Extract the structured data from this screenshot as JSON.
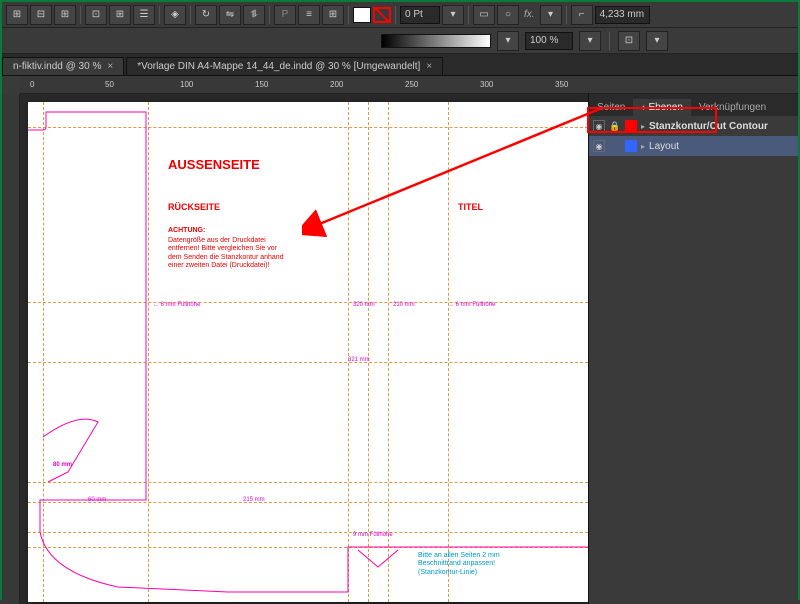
{
  "toolbar": {
    "stroke_pt": "0 Pt",
    "opacity": "100 %",
    "coord": "4,233 mm"
  },
  "tabs": {
    "t1": "n-fiktiv.indd @ 30 %",
    "t2": "*Vorlage DIN A4-Mappe 14_44_de.indd @ 30 % [Umgewandelt]"
  },
  "ruler": {
    "m0": "0",
    "m50": "50",
    "m100": "100",
    "m150": "150",
    "m200": "200",
    "m250": "250",
    "m300": "300",
    "m350": "350"
  },
  "doc": {
    "aussenseite": "AUSSENSEITE",
    "rueckseite": "RÜCKSEITE",
    "titel": "TITEL",
    "achtung_h": "ACHTUNG:",
    "achtung_t": "Datengröße aus der Druckdatei entfernen! Bitte vergleichen Sie vor dem Senden die Stanzkontur anhand einer zweiten Datei (Druckdatei)!",
    "fuell_l": "← 6 mm Füllhöhe",
    "fuell_r": "→ 6 mm Füllhöhe",
    "meas_320": "320 mm",
    "meas_210": "210 mm",
    "meas_321": "321 mm",
    "meas_215": "215 mm",
    "meas_80": "80 mm",
    "meas_60": "60 mm",
    "meas_9mm": "9 mm Füllhöhe",
    "bottom_note": "Bitte an allen Seiten 2 mm Beschnittrand anpassen! (Stanzkontur-Linie)"
  },
  "panel": {
    "tab_seiten": "Seiten",
    "tab_ebenen": "Ebenen",
    "tab_verk": "Verknüpfungen",
    "layer1": "Stanzkontur/Cut Contour",
    "layer2": "Layout"
  }
}
